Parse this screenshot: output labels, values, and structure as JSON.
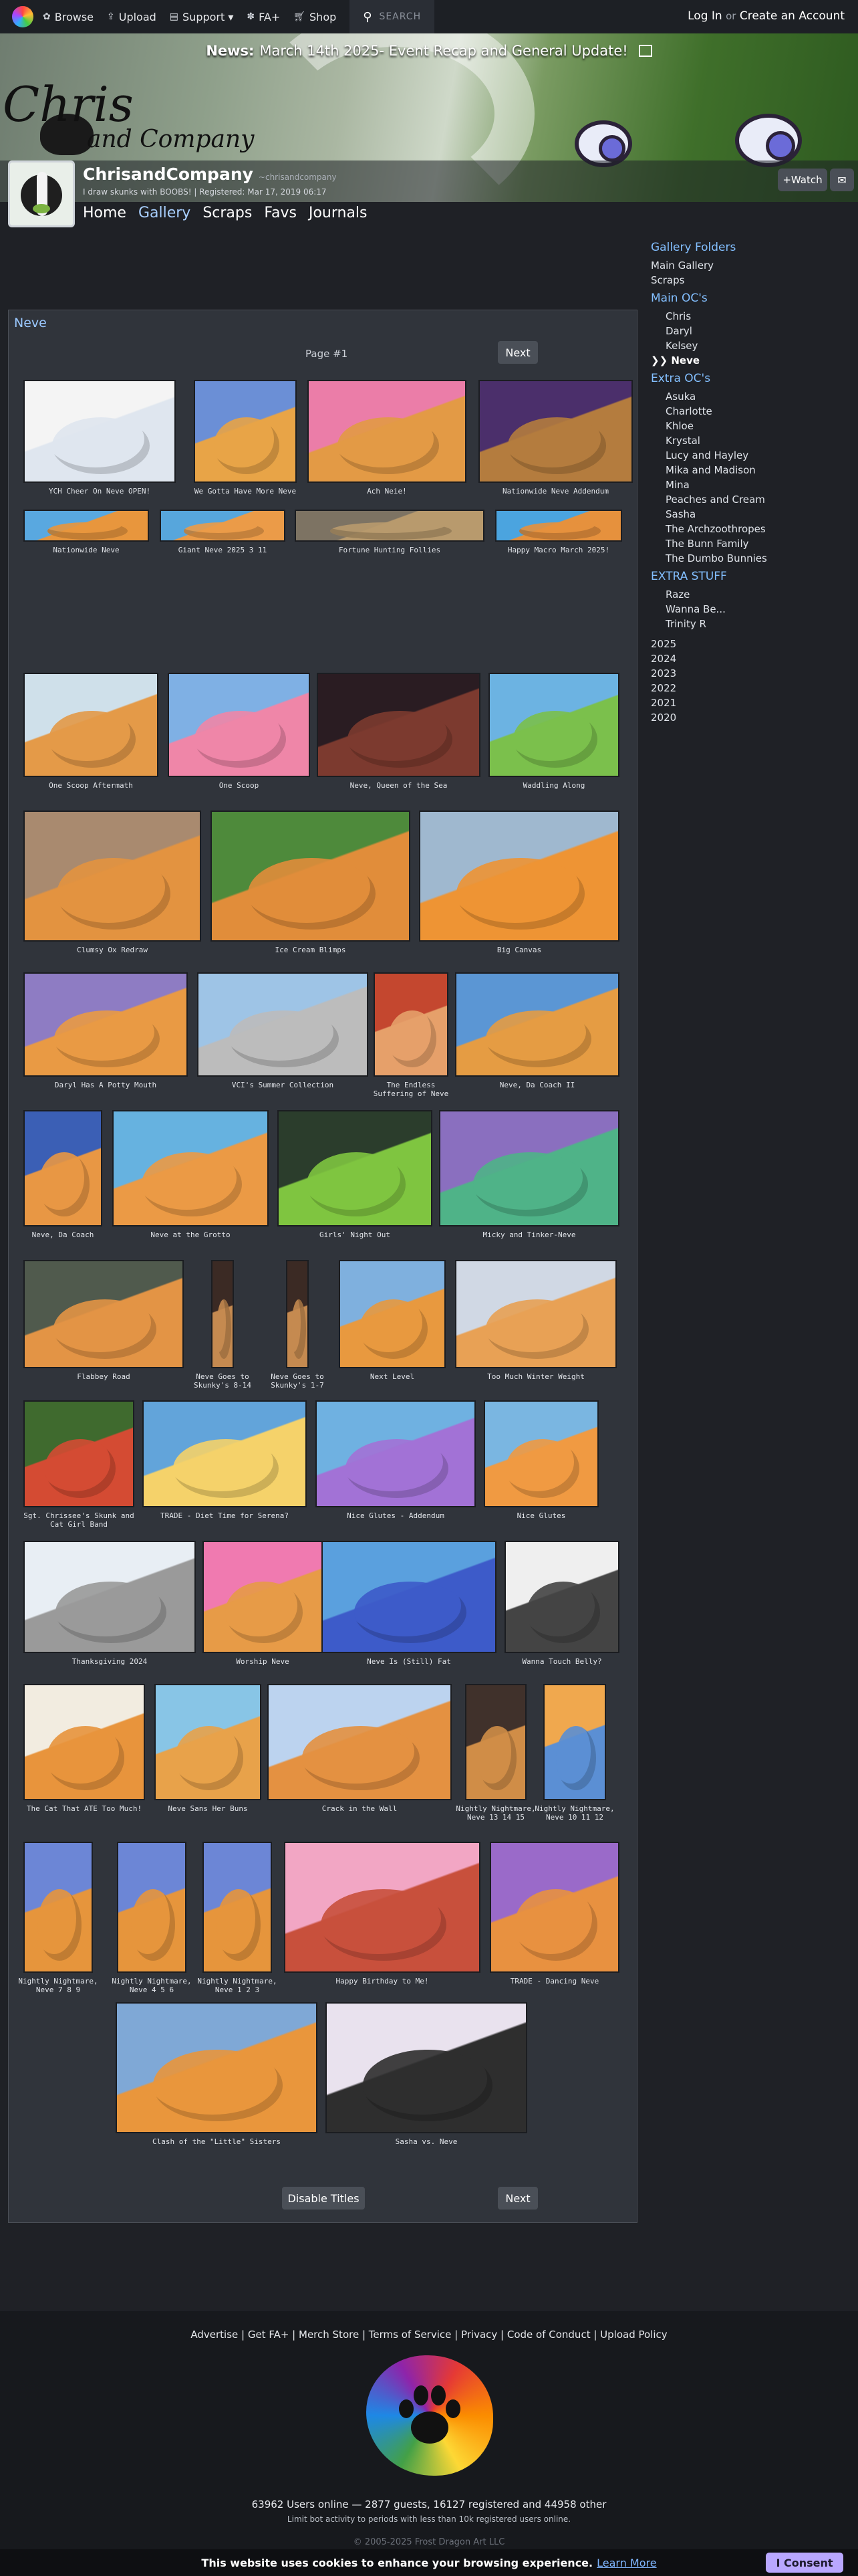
{
  "topbar": {
    "browse": "Browse",
    "upload": "Upload",
    "support": "Support ▾",
    "fa_plus": "FA+",
    "shop": "Shop",
    "search_placeholder": "SEARCH",
    "login": "Log In",
    "or": "or",
    "create": "Create an Account"
  },
  "banner": {
    "news_label": "News:",
    "news_text": "March 14th 2025- Event Recap and General Update!",
    "logo_line1": "Chris",
    "logo_line2": "and Company"
  },
  "profile": {
    "username": "ChrisandCompany",
    "handle": "~chrisandcompany",
    "tagline": "I draw skunks with BOOBS! | Registered: Mar 17, 2019 06:17",
    "watch": "+Watch",
    "tabs": [
      "Home",
      "Gallery",
      "Scraps",
      "Favs",
      "Journals"
    ],
    "active_tab": "Gallery"
  },
  "sidebar": {
    "folders_title": "Gallery Folders",
    "top_links": [
      "Main Gallery",
      "Scraps"
    ],
    "main_title": "Main OC's",
    "main_items": [
      "Chris",
      "Daryl",
      "Kelsey",
      "❯❯ Neve"
    ],
    "extra_title": "Extra OC's",
    "extra_items": [
      "Asuka",
      "Charlotte",
      "Khloe",
      "Krystal",
      "Lucy and Hayley",
      "Mika and Madison",
      "Mina",
      "Peaches and Cream",
      "Sasha",
      "The Archzoothropes",
      "The Bunn Family",
      "The Dumbo Bunnies"
    ],
    "stuff_title": "EXTRA STUFF",
    "stuff_items": [
      "Raze",
      "Wanna Be...",
      "Trinity R"
    ],
    "years": [
      "2025",
      "2024",
      "2023",
      "2022",
      "2021",
      "2020"
    ]
  },
  "gallery": {
    "folder_title": "Neve",
    "page_label": "Page #1",
    "next": "Next",
    "disable_titles": "Disable Titles",
    "items": [
      {
        "title": "YCH Cheer On Neve OPEN!"
      },
      {
        "title": "We Gotta Have More Neve"
      },
      {
        "title": "Ach Neie!"
      },
      {
        "title": "Nationwide Neve Addendum"
      },
      {
        "title": "Nationwide Neve"
      },
      {
        "title": "Giant Neve 2025 3 11"
      },
      {
        "title": "Fortune Hunting Follies"
      },
      {
        "title": "Happy Macro March 2025!"
      },
      {
        "title": "One Scoop Aftermath"
      },
      {
        "title": "One Scoop"
      },
      {
        "title": "Neve, Queen of the Sea"
      },
      {
        "title": "Waddling Along"
      },
      {
        "title": "Clumsy Ox Redraw"
      },
      {
        "title": "Ice Cream Blimps"
      },
      {
        "title": "Big Canvas"
      },
      {
        "title": "Daryl Has A Potty Mouth"
      },
      {
        "title": "VCI's Summer Collection"
      },
      {
        "title": "The Endless Suffering of Neve"
      },
      {
        "title": "Neve, Da Coach II"
      },
      {
        "title": "Neve, Da Coach"
      },
      {
        "title": "Neve at the Grotto"
      },
      {
        "title": "Girls' Night Out"
      },
      {
        "title": "Micky and Tinker-Neve"
      },
      {
        "title": "Flabbey Road"
      },
      {
        "title": "Neve Goes to Skunky's 8-14"
      },
      {
        "title": "Neve Goes to Skunky's 1-7"
      },
      {
        "title": "Next Level"
      },
      {
        "title": "Too Much Winter Weight"
      },
      {
        "title": "Sgt. Chrissee's Skunk and Cat Girl Band"
      },
      {
        "title": "TRADE - Diet Time for Serena?"
      },
      {
        "title": "Nice Glutes - Addendum"
      },
      {
        "title": "Nice Glutes"
      },
      {
        "title": "Thanksgiving 2024"
      },
      {
        "title": "Worship Neve"
      },
      {
        "title": "Neve Is (Still) Fat"
      },
      {
        "title": "Wanna Touch Belly?"
      },
      {
        "title": "The Cat That ATE Too Much!"
      },
      {
        "title": "Neve Sans Her Buns"
      },
      {
        "title": "Crack in the Wall"
      },
      {
        "title": "Nightly Nightmare, Neve 13 14 15"
      },
      {
        "title": "Nightly Nightmare, Neve 10 11 12"
      },
      {
        "title": "Nightly Nightmare, Neve 7 8 9"
      },
      {
        "title": "Nightly Nightmare, Neve 4 5 6"
      },
      {
        "title": "Nightly Nightmare, Neve 1 2 3"
      },
      {
        "title": "Happy Birthday to Me!"
      },
      {
        "title": "TRADE - Dancing Neve"
      },
      {
        "title": "Clash of the \"Little\" Sisters"
      },
      {
        "title": "Sasha vs. Neve"
      }
    ]
  },
  "footer": {
    "links": "Advertise | Get FA+ | Merch Store | Terms of Service | Privacy | Code of Conduct | Upload Policy",
    "online": "63962 Users online — 2877 guests, 16127 registered and 44958 other",
    "online_note": "Limit bot activity to periods with less than 10k registered users online.",
    "copyright": "© 2005-2025 Frost Dragon Art LLC"
  },
  "cookie": {
    "text": "This website uses cookies to enhance your browsing experience.",
    "learn": "Learn More",
    "consent": "I Consent"
  }
}
